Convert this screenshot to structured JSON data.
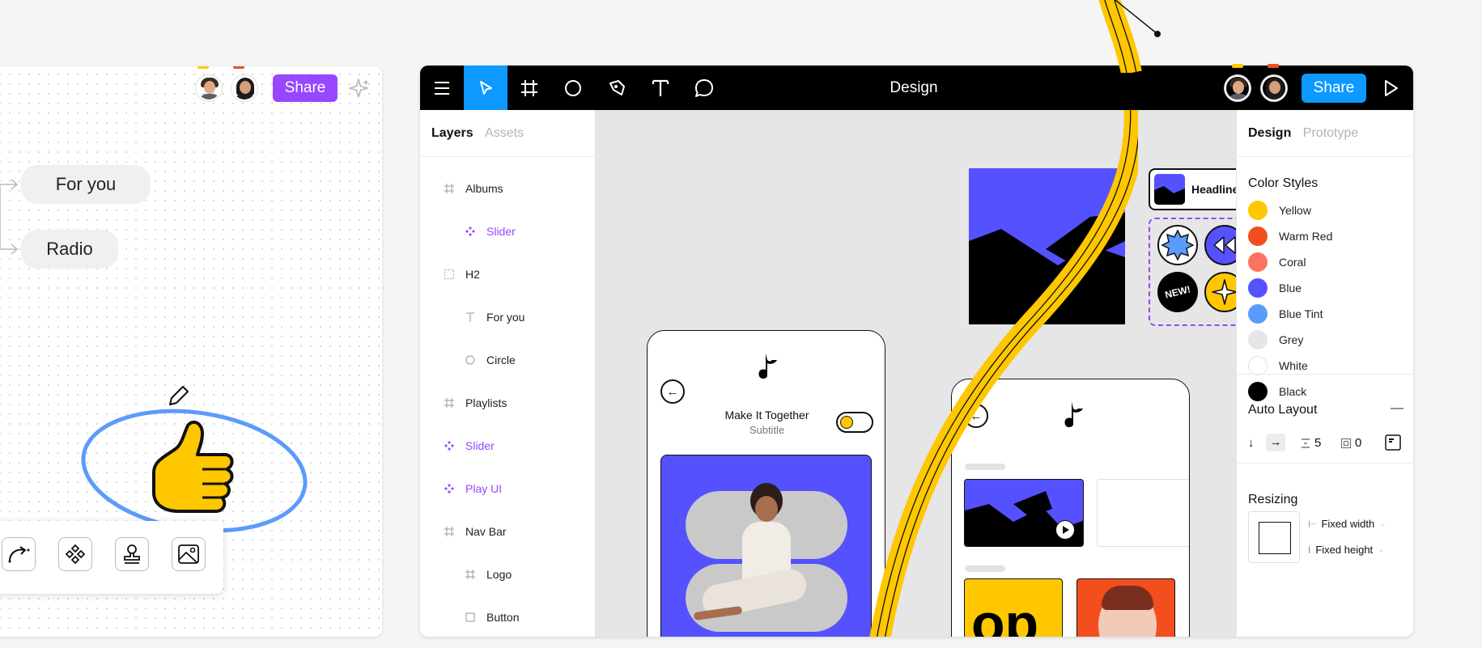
{
  "board": {
    "share_label": "Share",
    "flow_items": [
      "For you",
      "Radio"
    ]
  },
  "design_app": {
    "title": "Design",
    "share_label": "Share",
    "left_panel": {
      "tabs": [
        "Layers",
        "Assets"
      ],
      "layers": [
        {
          "label": "Albums",
          "icon": "frame-icon",
          "indent": 0,
          "component": false
        },
        {
          "label": "Slider",
          "icon": "component-icon",
          "indent": 1,
          "component": true
        },
        {
          "label": "H2",
          "icon": "section-icon",
          "indent": 0,
          "component": false
        },
        {
          "label": "For you",
          "icon": "text-icon",
          "indent": 1,
          "component": false
        },
        {
          "label": "Circle",
          "icon": "circle-icon",
          "indent": 1,
          "component": false
        },
        {
          "label": "Playlists",
          "icon": "frame-icon",
          "indent": 0,
          "component": false
        },
        {
          "label": "Slider",
          "icon": "component-icon",
          "indent": 0,
          "component": true
        },
        {
          "label": "Play UI",
          "icon": "component-icon",
          "indent": 0,
          "component": true
        },
        {
          "label": "Nav Bar",
          "icon": "frame-icon",
          "indent": 0,
          "component": false
        },
        {
          "label": "Logo",
          "icon": "frame-icon",
          "indent": 1,
          "component": false
        },
        {
          "label": "Button",
          "icon": "rectangle-icon",
          "indent": 1,
          "component": false
        }
      ]
    },
    "right_panel": {
      "tabs": [
        "Design",
        "Prototype"
      ],
      "color_styles_title": "Color Styles",
      "color_styles": [
        {
          "name": "Yellow",
          "color": "#ffc700"
        },
        {
          "name": "Warm Red",
          "color": "#f24e1e"
        },
        {
          "name": "Coral",
          "color": "#ff7262"
        },
        {
          "name": "Blue",
          "color": "#5551ff"
        },
        {
          "name": "Blue Tint",
          "color": "#5b9bfb"
        },
        {
          "name": "Grey",
          "color": "#e6e6e6"
        },
        {
          "name": "White",
          "color": "#ffffff"
        },
        {
          "name": "Black",
          "color": "#000000"
        }
      ],
      "auto_layout_title": "Auto Layout",
      "auto_layout_remove": "—",
      "spacing_value": "5",
      "padding_value": "0",
      "resizing_title": "Resizing",
      "resizing_options": [
        "Fixed width",
        "Fixed height"
      ]
    },
    "canvas": {
      "headline_label": "Headline",
      "new_badge": "NEW!",
      "phone1": {
        "title": "Make It Together",
        "subtitle": "Subtitle"
      }
    }
  },
  "colors": {
    "figma_purple": "#9747ff",
    "figma_blue": "#0d99ff",
    "accent_blue": "#5551ff",
    "yellow": "#ffc700"
  }
}
